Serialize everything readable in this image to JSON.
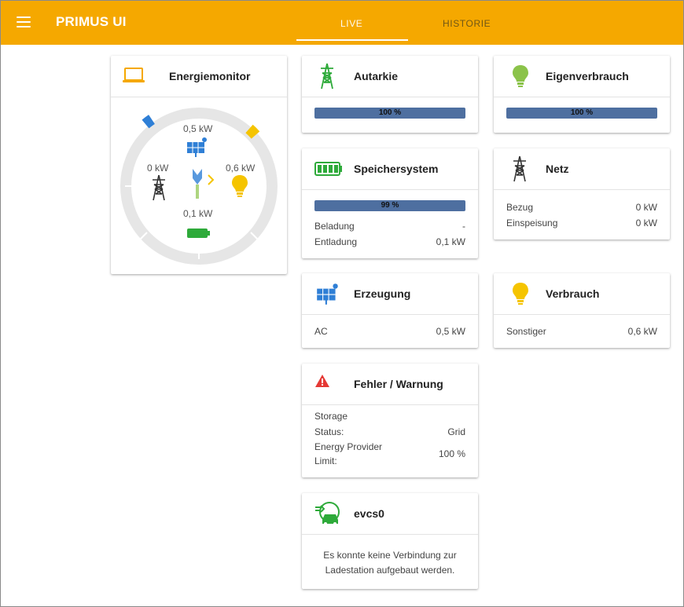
{
  "app": {
    "title": "PRIMUS UI"
  },
  "tabs": [
    {
      "label": "LIVE"
    },
    {
      "label": "HISTORIE"
    }
  ],
  "energiemonitor": {
    "title": "Energiemonitor",
    "production": "0,5 kW",
    "grid": "0 kW",
    "consumption": "0,6 kW",
    "storage": "0,1 kW"
  },
  "autarkie": {
    "title": "Autarkie",
    "value": "100 %",
    "percent": 100
  },
  "eigenverbrauch": {
    "title": "Eigenverbrauch",
    "value": "100 %",
    "percent": 100
  },
  "speichersystem": {
    "title": "Speichersystem",
    "value": "99 %",
    "percent": 99,
    "rows": [
      {
        "label": "Beladung",
        "value": "-"
      },
      {
        "label": "Entladung",
        "value": "0,1 kW"
      }
    ]
  },
  "netz": {
    "title": "Netz",
    "rows": [
      {
        "label": "Bezug",
        "value": "0 kW"
      },
      {
        "label": "Einspeisung",
        "value": "0 kW"
      }
    ]
  },
  "erzeugung": {
    "title": "Erzeugung",
    "rows": [
      {
        "label": "AC",
        "value": "0,5 kW"
      }
    ]
  },
  "verbrauch": {
    "title": "Verbrauch",
    "rows": [
      {
        "label": "Sonstiger",
        "value": "0,6 kW"
      }
    ]
  },
  "fehler": {
    "title": "Fehler / Warnung",
    "storage_label": "Storage",
    "status_label": "Status:",
    "status_value": "Grid",
    "limit_label_1": "Energy Provider",
    "limit_label_2": "Limit:",
    "limit_value": "100 %"
  },
  "evcs": {
    "title": "evcs0",
    "message_line1": "Es konnte keine Verbindung zur",
    "message_line2": "Ladestation aufgebaut werden."
  },
  "colors": {
    "brand": "#f5a800",
    "bar": "#4e6fa0",
    "battery": "#2eaa3a",
    "warning": "#e53935",
    "bulb": "#8bc34a",
    "bulb_yellow": "#f5c400",
    "solar": "#2f7fd6"
  }
}
